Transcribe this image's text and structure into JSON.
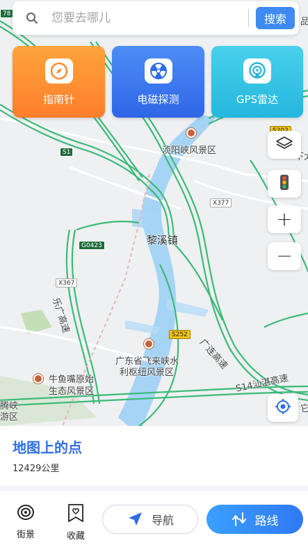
{
  "search": {
    "placeholder": "您要去哪儿",
    "button_label": "搜索"
  },
  "tiles": [
    {
      "label": "指南针",
      "icon": "compass-icon"
    },
    {
      "label": "电磁探测",
      "icon": "radiation-icon"
    },
    {
      "label": "GPS雷达",
      "icon": "radar-icon"
    }
  ],
  "map": {
    "places": {
      "scenic_1": "浈阳峡风景区",
      "town": "黎溪镇",
      "scenic_2_line1": "广东省飞来峡水",
      "scenic_2_line2": "利枢纽风景区",
      "scenic_3_line1": "牛鱼嘴原始",
      "scenic_3_line2": "生态风景区",
      "edge_left_1": "腾峡",
      "edge_left_2": "游区",
      "edge_right_1": "下太",
      "edge_right_2": "它"
    },
    "roads": {
      "s1": "S1",
      "g0423": "G0423",
      "x377": "X377",
      "x367": "X367",
      "s252": "S252",
      "s202": "S202",
      "top_left_78": "78",
      "top_right": "品",
      "highway_le": "乐广高速",
      "highway_gl": "广连高速",
      "highway_s14": "S14汕湛高速"
    }
  },
  "controls": {
    "layers_icon": "layers-icon",
    "traffic_icon": "traffic-light-icon",
    "zoom_in": "+",
    "zoom_out": "−",
    "locate_icon": "locate-icon"
  },
  "info": {
    "title": "地图上的点",
    "distance": "12429公里"
  },
  "bottom": {
    "street_label": "街景",
    "fav_label": "收藏",
    "nav_label": "导航",
    "route_label": "路线"
  },
  "colors": {
    "accent": "#3d8bf3",
    "tile_orange": "#ff8e33",
    "tile_blue": "#3a77ee",
    "tile_cyan": "#33c3e5",
    "road_green": "#2fb86f",
    "water": "#9fd0f3",
    "info_title": "#2f6fe6"
  }
}
